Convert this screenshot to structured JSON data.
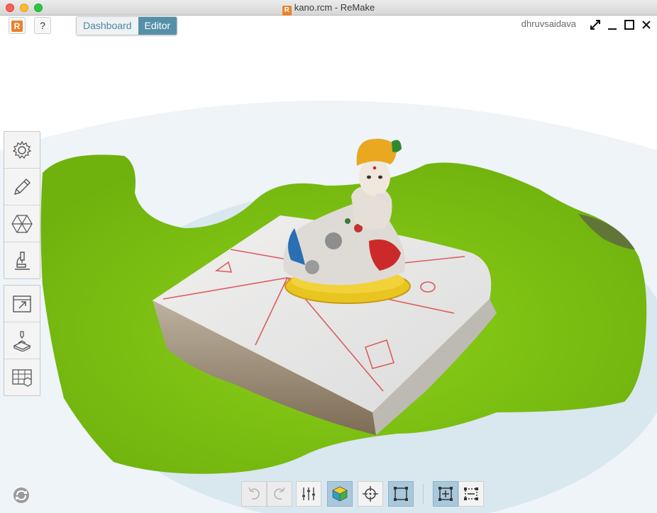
{
  "window": {
    "title": "kano.rcm - ReMake",
    "file_icon_letter": "R"
  },
  "topbar": {
    "logo_letter": "R",
    "help_label": "?",
    "modes": [
      {
        "label": "Dashboard",
        "active": false
      },
      {
        "label": "Editor",
        "active": true
      }
    ],
    "username": "dhruvsaidava"
  },
  "left_toolbar": {
    "group1": [
      {
        "icon": "gear-icon"
      },
      {
        "icon": "pencil-icon"
      },
      {
        "icon": "hexagon-mesh-icon"
      },
      {
        "icon": "microscope-icon"
      }
    ],
    "group2": [
      {
        "icon": "export-window-icon"
      },
      {
        "icon": "3d-print-icon"
      },
      {
        "icon": "grid-cube-icon"
      }
    ]
  },
  "bottom_toolbar": {
    "tools": [
      {
        "icon": "undo-icon",
        "state": "disabled"
      },
      {
        "icon": "redo-icon",
        "state": "disabled"
      },
      {
        "icon": "sliders-icon",
        "state": "normal"
      },
      {
        "icon": "shaded-cube-icon",
        "state": "active"
      },
      {
        "icon": "crosshair-icon",
        "state": "normal"
      },
      {
        "icon": "bounding-box-icon",
        "state": "active"
      },
      {
        "icon": "select-box-icon",
        "state": "active"
      },
      {
        "icon": "dashed-select-icon",
        "state": "normal"
      }
    ]
  },
  "colors": {
    "accent": "#5590a8",
    "ground": "#7cc214",
    "sky_disc": "#d7e6ee",
    "logo": "#e8822b"
  }
}
